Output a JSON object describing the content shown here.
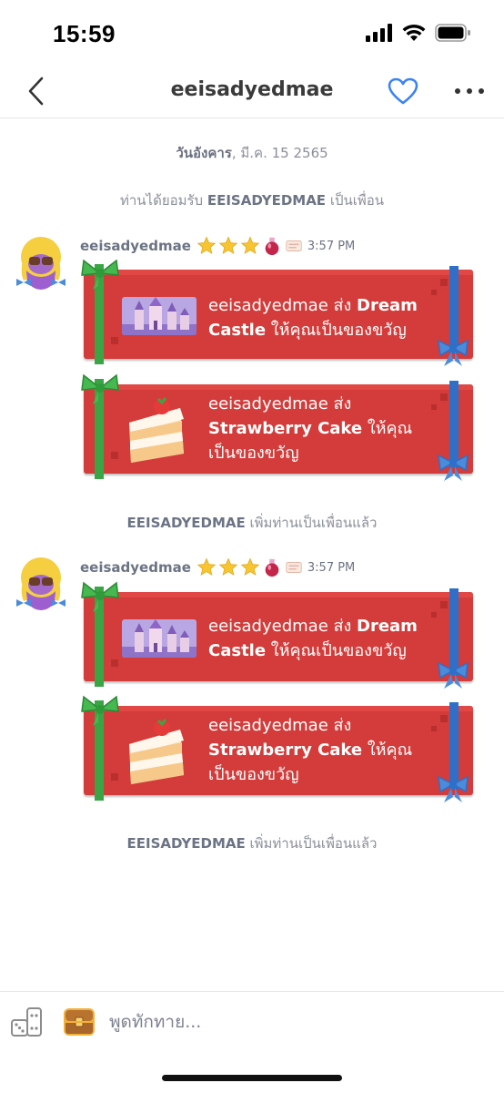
{
  "status_bar": {
    "time": "15:59"
  },
  "header": {
    "title": "eeisadyedmae",
    "accent": "#3b82f6"
  },
  "chat": {
    "date_prefix": "วันอังคาร",
    "date_rest": ", มี.ค. 15 2565",
    "accepted_pre": "ท่านได้ยอมรับ ",
    "accepted_name": "EEISADYEDMAE",
    "accepted_post": " เป็นเพื่อน",
    "groups": [
      {
        "sender": "eeisadyedmae",
        "time": "3:57 PM",
        "gift1": {
          "pre": "eeisadyedmae ส่ง ",
          "item": "Dream Castle",
          "post": " ให้คุณเป็นของขวัญ"
        },
        "gift2": {
          "pre": "eeisadyedmae ส่ง ",
          "item": "Strawberry Cake",
          "post": " ให้คุณเป็นของขวัญ"
        },
        "added_name": "EEISADYEDMAE",
        "added_post": " เพิ่มท่านเป็นเพื่อนแล้ว"
      },
      {
        "sender": "eeisadyedmae",
        "time": "3:57 PM",
        "gift1": {
          "pre": "eeisadyedmae ส่ง ",
          "item": "Dream Castle",
          "post": " ให้คุณเป็นของขวัญ"
        },
        "gift2": {
          "pre": "eeisadyedmae ส่ง ",
          "item": "Strawberry Cake",
          "post": " ให้คุณเป็นของขวัญ"
        },
        "added_name": "EEISADYEDMAE",
        "added_post": " เพิ่มท่านเป็นเพื่อนแล้ว"
      }
    ]
  },
  "input": {
    "placeholder": "พูดทักทาย..."
  },
  "colors": {
    "gift_red": "#d33c3a",
    "ribbon_green": "#3aa545",
    "ribbon_blue": "#2f6fc7",
    "meta_gray": "#6b7384"
  }
}
